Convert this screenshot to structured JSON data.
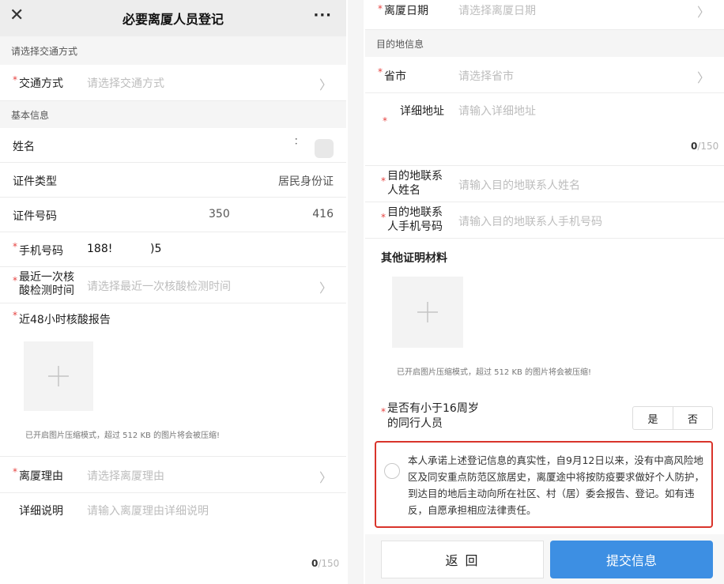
{
  "colors": {
    "required": "#e64340",
    "primary": "#3d8fe3",
    "highlight_border": "#d9342b",
    "placeholder": "#bdbdbd"
  },
  "left": {
    "nav": {
      "close_icon": "close-icon",
      "title": "必要离厦人员登记",
      "more": "···"
    },
    "transport_section": "请选择交通方式",
    "transport": {
      "required": "*",
      "label": "交通方式",
      "placeholder": "请选择交通方式"
    },
    "basic_section": "基本信息",
    "name": {
      "label": "姓名",
      "value": "："
    },
    "id_type": {
      "label": "证件类型",
      "value": "居民身份证"
    },
    "id_number": {
      "label": "证件号码",
      "value_start": "350",
      "value_end": "416"
    },
    "phone": {
      "required": "*",
      "label": "手机号码",
      "value_start": "188!",
      "value_end": ")5"
    },
    "last_test": {
      "required": "*",
      "label_line1": "最近一次核",
      "label_line2": "酸检测时间",
      "placeholder": "请选择最近一次核酸检测时间"
    },
    "report": {
      "required": "*",
      "label": "近48小时核酸报告"
    },
    "compress_note": "已开启图片压缩模式，超过 512 KB 的图片将会被压缩!",
    "reason": {
      "required": "*",
      "label": "离厦理由",
      "placeholder": "请选择离厦理由"
    },
    "detail": {
      "label": "详细说明",
      "placeholder": "请输入离厦理由详细说明"
    },
    "counter": {
      "current": "0",
      "max": "/150"
    }
  },
  "right": {
    "date": {
      "required": "*",
      "label": "离厦日期",
      "placeholder": "请选择离厦日期"
    },
    "dest_section": "目的地信息",
    "province": {
      "required": "*",
      "label": "省市",
      "placeholder": "请选择省市"
    },
    "address": {
      "required": "*",
      "label": "详细地址",
      "placeholder": "请输入详细地址"
    },
    "counter": {
      "current": "0",
      "max": "/150"
    },
    "contact_name": {
      "required": "*",
      "label_line1": "目的地联系",
      "label_line2": "人姓名",
      "placeholder": "请输入目的地联系人姓名"
    },
    "contact_phone": {
      "required": "*",
      "label_line1": "目的地联系",
      "label_line2": "人手机号码",
      "placeholder": "请输入目的地联系人手机号码"
    },
    "other_materials": "其他证明材料",
    "compress_note": "已开启图片压缩模式，超过 512 KB 的图片将会被压缩!",
    "minor": {
      "required": "*",
      "label_line1": "是否有小于16周岁",
      "label_line2": "的同行人员",
      "yes": "是",
      "no": "否"
    },
    "pledge": "本人承诺上述登记信息的真实性，自9月12日以来，没有中高风险地区及同安重点防范区旅居史，离厦途中将按防疫要求做好个人防护，到达目的地后主动向所在社区、村（居）委会报告、登记。如有违反，自愿承担相应法律责任。",
    "back_button": "返 回",
    "submit_button": "提交信息"
  }
}
